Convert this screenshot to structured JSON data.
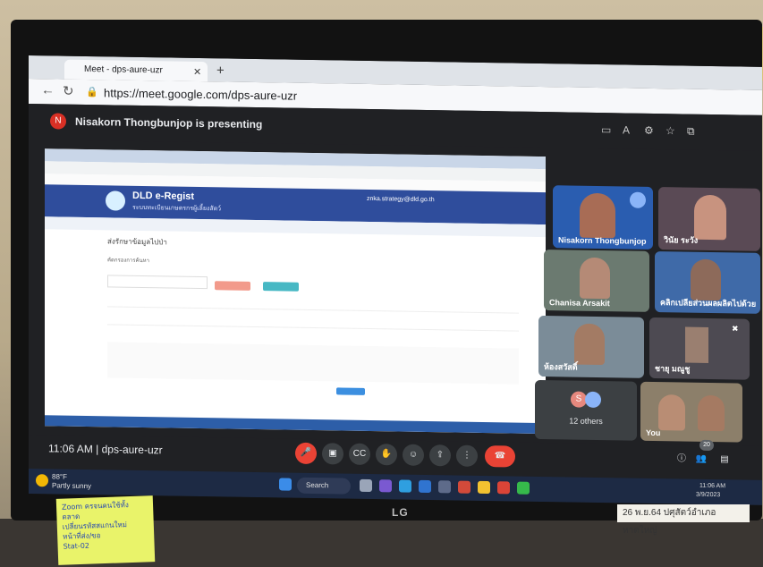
{
  "browser": {
    "tab_title": "Meet - dps-aure-uzr",
    "url": "https://meet.google.com/dps-aure-uzr"
  },
  "meet": {
    "presenter_initial": "N",
    "presenting_text": "Nisakorn Thongbunjop is presenting",
    "meeting_code": "11:06 AM  |  dps-aure-uzr",
    "others_label": "12 others",
    "others_initial": "S",
    "participant_count": "20"
  },
  "participants": [
    {
      "name": "Nisakorn Thongbunjop"
    },
    {
      "name": "วินัย ระวัง"
    },
    {
      "name": "Chanisa Arsakit"
    },
    {
      "name": "คลิกเปลียส่วนผลผลิตไปด้วย"
    },
    {
      "name": "ห้องสวัสดิ์"
    },
    {
      "name": "ชายุ มณูชู"
    },
    {
      "name": "You"
    }
  ],
  "shared_screen": {
    "app_title": "DLD e-Regist",
    "app_subtitle": "ระบบทะเบียนเกษตรกรผู้เลี้ยงสัตว์",
    "user_email": "znka.strategy@dld.go.th",
    "page_heading": "ส่งรักษาข้อมูลไปป่า",
    "sub_heading": "คัดกรองการค้นหา"
  },
  "taskbar": {
    "temp": "88°F",
    "weather": "Partly sunny",
    "search": "Search",
    "time": "11:06 AM",
    "date": "3/9/2023"
  },
  "physical": {
    "monitor_brand": "LG",
    "label_tag": "26 พ.ย.64 ปศุสัตว์อำเภอ หาดใหญ่",
    "sticky_lines": [
      "Zoom ครจนคนใช้ทั้ง ตลาด",
      "เปลี่ยนรหัสสแกนใหม่",
      "หน้าที่ส่ง/ขอ",
      "Stat-02"
    ]
  }
}
